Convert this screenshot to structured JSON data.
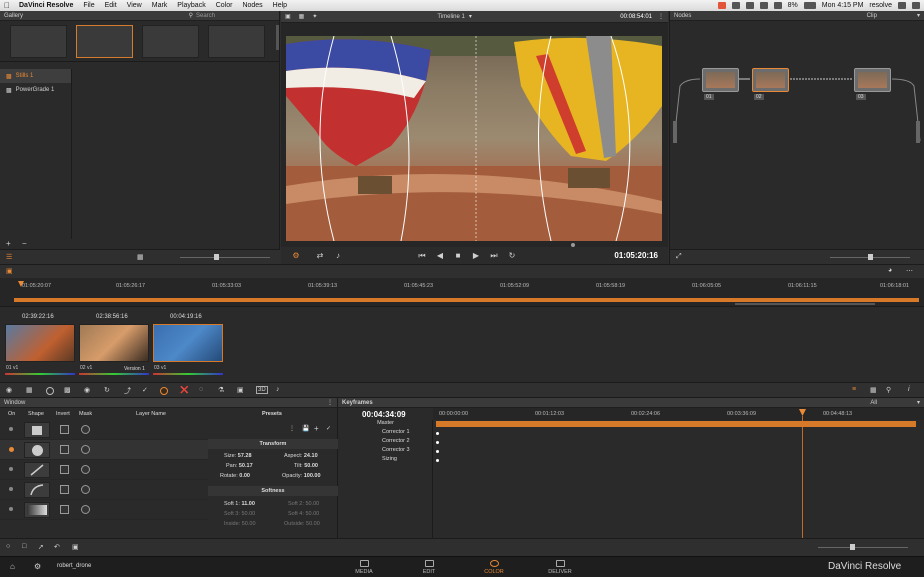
{
  "menubar": {
    "app_name": "DaVinci Resolve",
    "menus": [
      "File",
      "Edit",
      "View",
      "Mark",
      "Playback",
      "Color",
      "Nodes",
      "Help"
    ],
    "battery": "8%",
    "clock": "Mon 4:15 PM",
    "user": "resolve"
  },
  "gallery": {
    "title": "Gallery",
    "search_placeholder": "Search",
    "albums": [
      "Stills 1",
      "PowerGrade 1"
    ]
  },
  "viewer": {
    "timeline_name": "Timeline 1",
    "timecode_top": "00:08:54:01",
    "timecode": "01:05:20:16"
  },
  "nodes": {
    "title": "Nodes",
    "mode": "Clip",
    "labels": [
      "01",
      "02",
      "03"
    ]
  },
  "timeline": {
    "ruler_ticks": [
      "01:05:20:07",
      "01:05:26:17",
      "01:05:33:03",
      "01:05:39:13",
      "01:05:45:23",
      "01:05:52:09",
      "01:05:58:19",
      "01:06:05:05",
      "01:06:11:15",
      "01:06:18:01"
    ],
    "clips": [
      {
        "tc": "02:39:22:16",
        "num": "01",
        "track": "v1"
      },
      {
        "tc": "02:38:56:16",
        "num": "02",
        "track": "v1"
      },
      {
        "tc": "00:04:19:16",
        "num": "03",
        "track": "v1"
      }
    ],
    "version_label": "Version 1"
  },
  "window_palette": {
    "title": "Window",
    "headers": [
      "On",
      "Shape",
      "Invert",
      "Mask",
      "Layer Name"
    ],
    "presets_title": "Presets",
    "transform_title": "Transform",
    "transform": {
      "size_label": "Size:",
      "size": "57.28",
      "aspect_label": "Aspect:",
      "aspect": "24.10",
      "pan_label": "Pan:",
      "pan": "50.17",
      "tilt_label": "Tilt:",
      "tilt": "50.00",
      "rotate_label": "Rotate:",
      "rotate": "0.00",
      "opacity_label": "Opacity:",
      "opacity": "100.00"
    },
    "softness_title": "Softness",
    "softness": {
      "soft1_label": "Soft 1:",
      "soft1": "11.00",
      "soft2_label": "Soft 2:",
      "soft2": "50.00",
      "soft3_label": "Soft 3:",
      "soft3": "50.00",
      "soft4_label": "Soft 4:",
      "soft4": "50.00",
      "inside_label": "Inside:",
      "inside": "50.00",
      "outside_label": "Outside:",
      "outside": "50.00"
    }
  },
  "keyframes": {
    "title": "Keyframes",
    "filter": "All",
    "current_tc": "00:04:34:09",
    "ruler": [
      "00:00:00:00",
      "00:01:12:03",
      "00:02:24:06",
      "00:03:36:09",
      "00:04:48:13"
    ],
    "tracks": [
      "Master",
      "Corrector 1",
      "Corrector 2",
      "Corrector 3",
      "Sizing"
    ]
  },
  "pagebar": {
    "project": "robert_drone",
    "pages": [
      "MEDIA",
      "EDIT",
      "COLOR",
      "DELIVER"
    ],
    "active_page": "COLOR",
    "brand": "DaVinci Resolve",
    "accent": "#e88a36"
  }
}
